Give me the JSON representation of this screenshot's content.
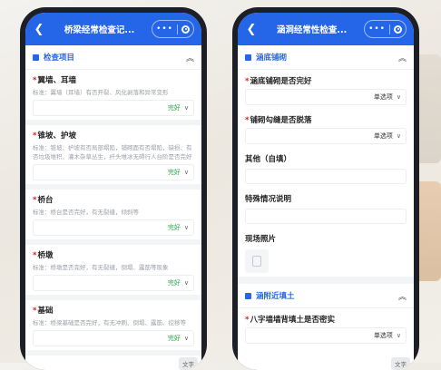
{
  "left": {
    "title": "桥梁经常检查记...",
    "section_title": "检查项目",
    "items": [
      {
        "label": "翼墙、耳墙",
        "hint": "标准：翼墙（耳墙）有否开裂、风化剥落和异常变形",
        "value": "完好"
      },
      {
        "label": "锥坡、护坡",
        "hint": "标准：锥坡、护坡有否局部塌陷，铺砌面有否塌陷，缺损、有否垃圾堆积、灌木杂草丛生，纤头堆冰无碍行人台阶是否完好",
        "value": "完好"
      },
      {
        "label": "桥台",
        "hint": "标准：桥台是否完好，有无裂缝，倾斜等",
        "value": "完好"
      },
      {
        "label": "桥墩",
        "hint": "标准：桥墩是否完好，有无裂缝，倒塌、露筋等现象",
        "value": "完好"
      },
      {
        "label": "基础",
        "hint": "标准：桥梁基础是否完好，有无冲刷、倒塌、露筋、挖移等",
        "value": "完好"
      }
    ],
    "float_label": "文字"
  },
  "right": {
    "title": "涵洞经常性检查...",
    "section1_title": "涵底铺砌",
    "q1": {
      "label": "涵底铺砌是否完好",
      "placeholder": "单选项"
    },
    "q2": {
      "label": "铺砌勾缝是否脱落",
      "placeholder": "单选项"
    },
    "other_label": "其他（自填）",
    "special_label": "特殊情况说明",
    "photo_label": "现场照片",
    "section2_title": "涵附近填土",
    "q3": {
      "label": "八字墙墙背填土是否密实",
      "placeholder": "单选项"
    },
    "float_label": "文字"
  },
  "colors": {
    "primary": "#2566e8",
    "required": "#e02020",
    "good": "#27a844"
  }
}
